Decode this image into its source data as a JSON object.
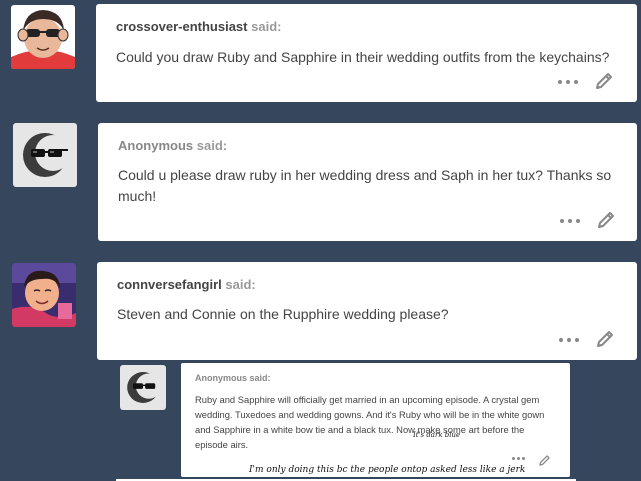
{
  "posts": [
    {
      "asker": "crossover-enthusiast",
      "said": "said:",
      "question": "Could you draw Ruby and Sapphire in their wedding outfits from the keychains?",
      "avatar": "cartoon-sunglasses-avatar"
    },
    {
      "asker": "Anonymous",
      "said": "said:",
      "question": "Could u please draw ruby in her wedding dress and Saph in her tux? Thanks so much!",
      "avatar": "anonymous-sunglasses-avatar"
    },
    {
      "asker": "connversefangirl",
      "said": "said:",
      "question": "Steven and Connie on the Rupphire wedding please?",
      "avatar": "steven-character-avatar"
    }
  ],
  "embedded": {
    "asker": "Anonymous said:",
    "question": "Ruby and Sapphire will officially get married in an upcoming episode. A crystal gem wedding. Tuxedoes and wedding gowns. And it's Ruby who will be in the white gown and Sapphire in a white bow tie and a black tux. Now make some art before the episode airs.",
    "note_small": "It's dark blue",
    "note_big": "I'm only doing this bc the people ontop asked less like a jerk"
  },
  "icons": {
    "more": "more-options-icon",
    "edit": "pencil-edit-icon"
  },
  "colors": {
    "background": "#36465d",
    "card": "#ffffff",
    "asker_text": "#444444",
    "said_text": "#999999",
    "icon": "#888888"
  }
}
